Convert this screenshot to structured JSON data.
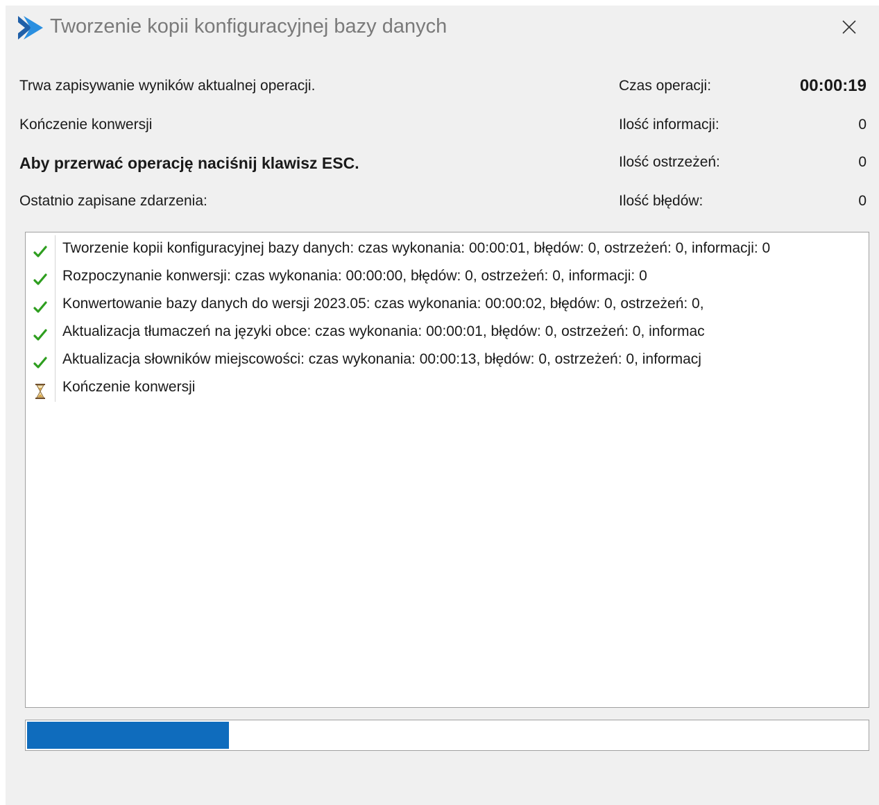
{
  "window": {
    "title": "Tworzenie kopii konfiguracyjnej bazy danych"
  },
  "status": {
    "current_operation": "Trwa zapisywanie wyników aktualnej operacji.",
    "current_step": "Kończenie konwersji",
    "esc_hint": "Aby przerwać operację naciśnij klawisz ESC.",
    "recent_events_label": "Ostatnio zapisane zdarzenia:"
  },
  "stats": {
    "time_label": "Czas operacji:",
    "time_value": "00:00:19",
    "info_label": "Ilość informacji:",
    "info_value": "0",
    "warnings_label": "Ilość ostrzeżeń:",
    "warnings_value": "0",
    "errors_label": "Ilość błędów:",
    "errors_value": "0"
  },
  "log": [
    {
      "icon": "checkmark-icon",
      "text": "Tworzenie kopii konfiguracyjnej bazy danych: czas wykonania: 00:00:01, błędów: 0, ostrzeżeń: 0, informacji: 0"
    },
    {
      "icon": "checkmark-icon",
      "text": "Rozpoczynanie konwersji: czas wykonania: 00:00:00, błędów: 0, ostrzeżeń: 0, informacji: 0"
    },
    {
      "icon": "checkmark-icon",
      "text": "Konwertowanie bazy danych do wersji 2023.05: czas wykonania: 00:00:02, błędów: 0, ostrzeżeń: 0,"
    },
    {
      "icon": "checkmark-icon",
      "text": "Aktualizacja tłumaczeń na języki obce: czas wykonania: 00:00:01, błędów: 0, ostrzeżeń: 0, informac"
    },
    {
      "icon": "checkmark-icon",
      "text": "Aktualizacja słowników miejscowości: czas wykonania: 00:00:13, błędów: 0, ostrzeżeń: 0, informacj"
    },
    {
      "icon": "hourglass-icon",
      "text": "Kończenie konwersji"
    }
  ],
  "progress": {
    "fraction": 0.24
  },
  "colors": {
    "accent": "#0f6cbd",
    "check": "#2e9e1f",
    "background": "#f0f0f0"
  }
}
